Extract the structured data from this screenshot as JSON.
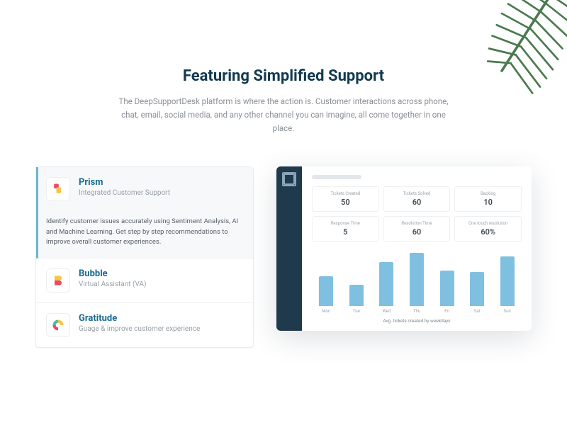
{
  "hero": {
    "title": "Featuring Simplified Support",
    "subtitle": "The DeepSupportDesk platform is where the action is. Customer interactions across phone, chat, email, social media, and any other channel you can imagine, all come together in one place."
  },
  "features": [
    {
      "key": "prism",
      "title": "Prism",
      "subtitle": "Integrated Customer Support",
      "desc": "Identify customer issues accurately using Sentiment Analysis, AI and Machine Learning. Get step by step recommendations to improve overall customer experiences.",
      "active": true
    },
    {
      "key": "bubble",
      "title": "Bubble",
      "subtitle": "Virtual Assistant (VA)",
      "active": false
    },
    {
      "key": "gratitude",
      "title": "Gratitude",
      "subtitle": "Guage & improve customer experience",
      "active": false
    }
  ],
  "dashboard": {
    "stats": [
      {
        "label": "Tickets Created",
        "value": "50"
      },
      {
        "label": "Tickets Solved",
        "value": "60"
      },
      {
        "label": "Backlog",
        "value": "10"
      },
      {
        "label": "Response Time",
        "value": "5"
      },
      {
        "label": "Resolution Time",
        "value": "60"
      },
      {
        "label": "One touch resolution",
        "value": "60%"
      }
    ],
    "caption": "Avg. tickets created by weekdays"
  },
  "chart_data": {
    "type": "bar",
    "categories": [
      "Mon",
      "Tue",
      "Wed",
      "Thu",
      "Fri",
      "Sat",
      "Sun"
    ],
    "values": [
      42,
      30,
      62,
      75,
      50,
      48,
      70
    ],
    "title": "Avg. tickets created by weekdays",
    "xlabel": "",
    "ylabel": "",
    "ylim": [
      0,
      80
    ]
  }
}
